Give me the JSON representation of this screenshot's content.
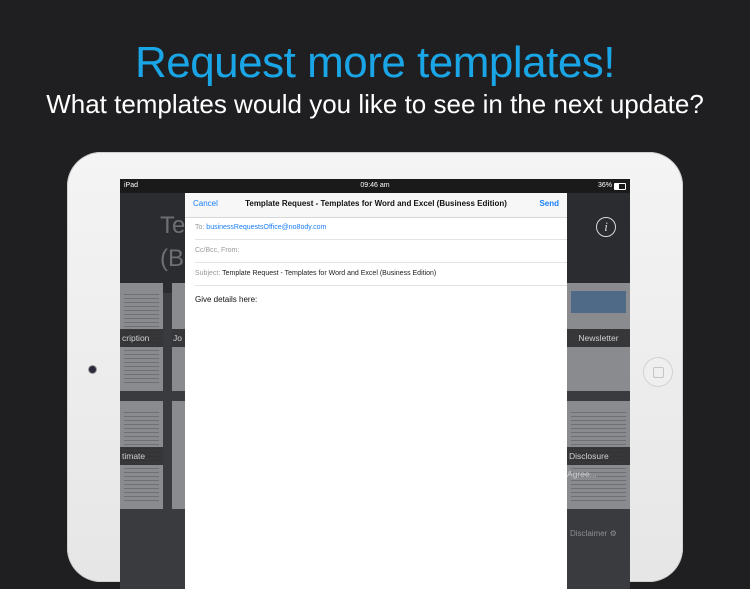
{
  "headline": "Request more templates!",
  "subline": "What templates would you like to see in the next update?",
  "colors": {
    "accent": "#1aa6e6",
    "ios_blue": "#1a7ff6",
    "background": "#1f1f21"
  },
  "statusbar": {
    "device": "iPad",
    "time": "09:46 am",
    "battery": "36%"
  },
  "background_app": {
    "title_fragment_1": "Te",
    "title_fragment_2": "(B",
    "info_icon": "i",
    "tiles": {
      "row1": [
        "cription",
        "Jo",
        "Newsletter"
      ],
      "row2": [
        "timate",
        "Disclosure Agree..."
      ],
      "footer": "Disclaimer"
    }
  },
  "mail": {
    "cancel": "Cancel",
    "title": "Template Request - Templates for Word and Excel (Business Edition)",
    "send": "Send",
    "to_label": "To:",
    "to_value": "businessRequestsOffice@no8ody.com",
    "cc_label": "Cc/Bcc, From:",
    "subject_label": "Subject:",
    "subject_value": "Template Request - Templates for Word and Excel (Business Edition)",
    "body": "Give details here:"
  }
}
